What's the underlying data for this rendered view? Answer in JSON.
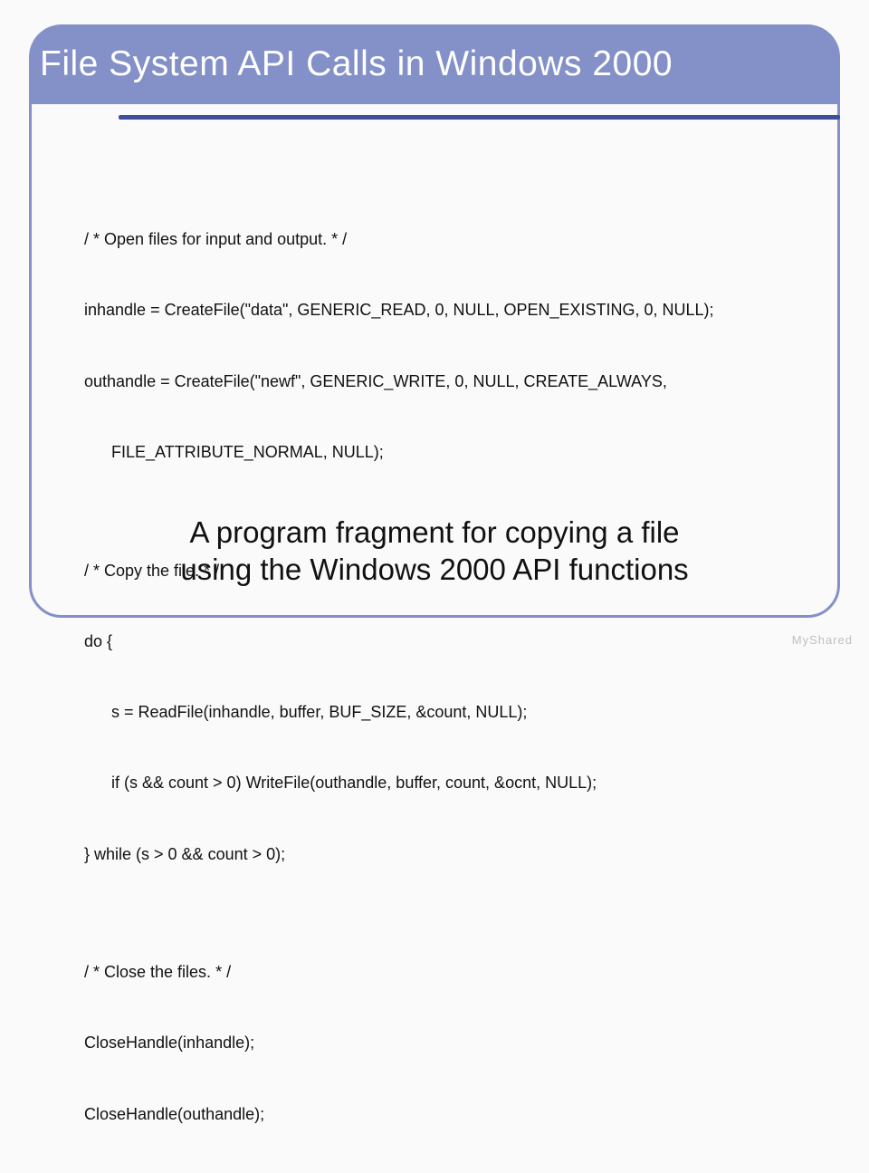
{
  "title": "File System API Calls in Windows 2000",
  "code_lines": [
    "/ * Open files for input and output. * /",
    "inhandle = CreateFile(\"data\", GENERIC_READ, 0, NULL, OPEN_EXISTING, 0, NULL);",
    "outhandle = CreateFile(\"newf\", GENERIC_WRITE, 0, NULL, CREATE_ALWAYS,",
    "      FILE_ATTRIBUTE_NORMAL, NULL);",
    "",
    "/ * Copy the file. * /",
    "do {",
    "      s = ReadFile(inhandle, buffer, BUF_SIZE, &count, NULL);",
    "      if (s && count > 0) WriteFile(outhandle, buffer, count, &ocnt, NULL);",
    "} while (s > 0 && count > 0);",
    "",
    "/ * Close the files. * /",
    "CloseHandle(inhandle);",
    "CloseHandle(outhandle);"
  ],
  "caption_line1": "A program fragment for copying a file",
  "caption_line2": "using the Windows 2000 API functions",
  "watermark": "MyShared"
}
